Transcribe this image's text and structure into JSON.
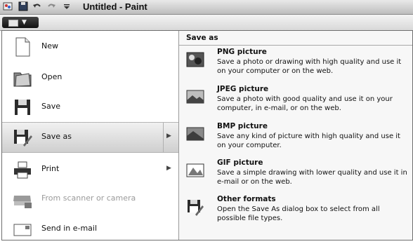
{
  "window": {
    "title": "Untitled - Paint"
  },
  "menu": {
    "left_items": [
      {
        "label": "New"
      },
      {
        "label": "Open"
      },
      {
        "label": "Save"
      },
      {
        "label": "Save as"
      },
      {
        "label": "Print"
      },
      {
        "label": "From scanner or camera"
      },
      {
        "label": "Send in e-mail"
      }
    ],
    "right_header": "Save as",
    "save_options": [
      {
        "title": "PNG picture",
        "desc": "Save a photo or drawing with high quality and use it on your computer or on the web."
      },
      {
        "title": "JPEG picture",
        "desc": "Save a photo with good quality and use it on your computer, in e-mail, or on the web."
      },
      {
        "title": "BMP picture",
        "desc": "Save any kind of picture with high quality and use it on your computer."
      },
      {
        "title": "GIF picture",
        "desc": "Save a simple drawing with lower quality and use it in e-mail or on the web."
      },
      {
        "title": "Other formats",
        "desc": "Open the Save As dialog box to select from all possible file types."
      }
    ]
  },
  "icons": {
    "qat": [
      "paint-app-icon",
      "save-icon",
      "undo-icon",
      "redo-icon",
      "customize-qat-icon"
    ],
    "left": [
      "new-document-icon",
      "open-folder-icon",
      "save-disk-icon",
      "save-as-icon",
      "printer-icon",
      "scanner-icon",
      "email-icon"
    ],
    "right": [
      "png-icon",
      "jpeg-icon",
      "bmp-icon",
      "gif-icon",
      "other-formats-icon"
    ]
  },
  "colors": {
    "selected_bg": "#d6d6d6",
    "disabled_text": "#9a9a9a",
    "titlebar": "#cfcfcf"
  }
}
